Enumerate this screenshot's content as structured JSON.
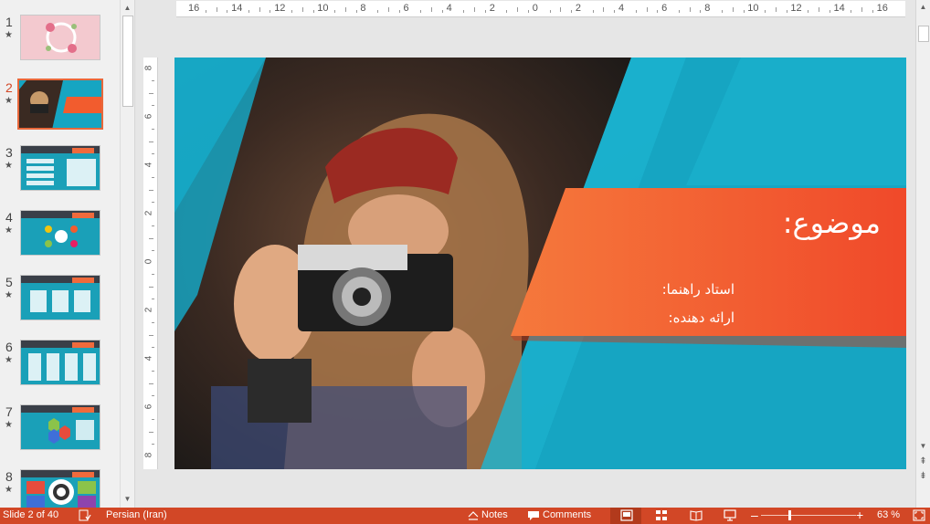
{
  "thumbnails": [
    {
      "num": "1",
      "star": "★",
      "style": "floral"
    },
    {
      "num": "2",
      "star": "★",
      "style": "photo",
      "selected": true
    },
    {
      "num": "3",
      "star": "★",
      "style": "grid"
    },
    {
      "num": "4",
      "star": "★",
      "style": "circle"
    },
    {
      "num": "5",
      "star": "★",
      "style": "cards"
    },
    {
      "num": "6",
      "star": "★",
      "style": "columns"
    },
    {
      "num": "7",
      "star": "★",
      "style": "hex"
    },
    {
      "num": "8",
      "star": "★",
      "style": "target"
    }
  ],
  "ruler": {
    "h_labels": [
      "16",
      "14",
      "12",
      "10",
      "8",
      "6",
      "4",
      "2",
      "0",
      "2",
      "4",
      "6",
      "8",
      "10",
      "12",
      "14",
      "16"
    ],
    "v_labels": [
      "8",
      "6",
      "4",
      "2",
      "0",
      "2",
      "4",
      "6",
      "8"
    ]
  },
  "slide": {
    "title": "موضوع:",
    "line1": "استاد راهنما:",
    "line2": "ارائه دهنده:",
    "colors": {
      "teal": "#16a5c2",
      "orange": "#f25c2e",
      "orange_light": "#f5793c"
    }
  },
  "status": {
    "slide_info": "Slide 2 of 40",
    "language": "Persian (Iran)",
    "notes": "Notes",
    "comments": "Comments",
    "zoom": "63 %"
  },
  "icons": {
    "scroll_up": "▲",
    "scroll_down": "▼",
    "prev_slide": "⇞",
    "next_slide": "⇟"
  }
}
